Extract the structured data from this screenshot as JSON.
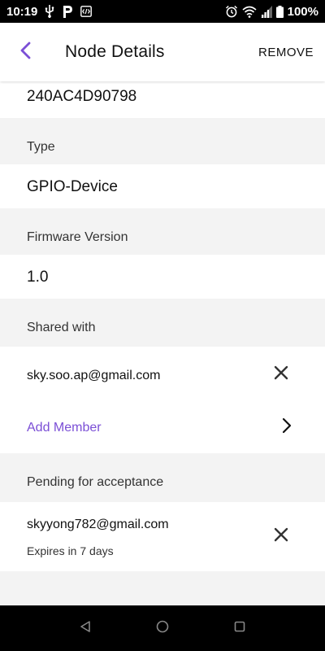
{
  "status_bar": {
    "time": "10:19",
    "battery": "100%",
    "icons_left": [
      "usb-icon",
      "parking-icon",
      "code-icon"
    ],
    "icons_right": [
      "alarm-icon",
      "wifi-icon",
      "signal-icon",
      "battery-icon"
    ]
  },
  "app_bar": {
    "title": "Node Details",
    "remove_label": "REMOVE",
    "accent_color": "#7b4fd6"
  },
  "details": {
    "node_id": "240AC4D90798",
    "type_label": "Type",
    "type_value": "GPIO-Device",
    "firmware_label": "Firmware Version",
    "firmware_value": "1.0"
  },
  "shared": {
    "label": "Shared with",
    "members": [
      {
        "email": "sky.soo.ap@gmail.com"
      }
    ],
    "add_member_label": "Add Member"
  },
  "pending": {
    "label": "Pending for acceptance",
    "items": [
      {
        "email": "skyyong782@gmail.com",
        "expires": "Expires in 7 days"
      }
    ]
  }
}
